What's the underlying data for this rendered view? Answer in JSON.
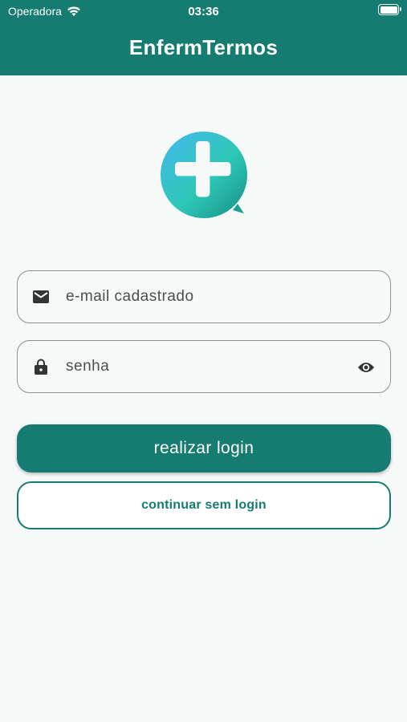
{
  "status_bar": {
    "carrier": "Operadora",
    "time": "03:36"
  },
  "app_bar": {
    "title": "EnfermTermos"
  },
  "logo": {
    "icon": "medical-cross-icon"
  },
  "login_form": {
    "email_placeholder": "e-mail cadastrado",
    "email_value": "",
    "email_icon": "mail-icon",
    "password_placeholder": "senha",
    "password_value": "",
    "password_icon": "lock-icon",
    "password_toggle_icon": "eye-icon"
  },
  "buttons": {
    "login_label": "realizar login",
    "guest_label": "continuar sem login"
  },
  "colors": {
    "primary": "#167b70",
    "background": "#f7f9f9"
  }
}
